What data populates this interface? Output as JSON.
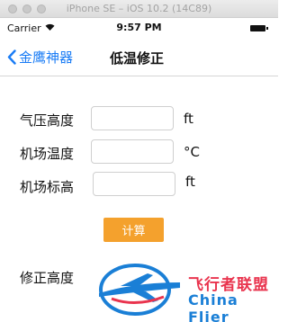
{
  "simulator": {
    "title": "iPhone SE – iOS 10.2 (14C89)"
  },
  "status_bar": {
    "carrier": "Carrier",
    "time": "9:57 PM"
  },
  "nav": {
    "back_label": "金鹰神器",
    "title": "低温修正"
  },
  "form": {
    "rows": [
      {
        "label": "气压高度",
        "value": "",
        "placeholder": "",
        "unit": "ft"
      },
      {
        "label": "机场温度",
        "value": "",
        "placeholder": "",
        "unit": "°C"
      },
      {
        "label": "机场标高",
        "value": "",
        "placeholder": "",
        "unit": "ft"
      }
    ],
    "calc_button": "计算",
    "result_label": "修正高度"
  },
  "watermark": {
    "cn": "飞行者联盟",
    "en": "China Flier"
  },
  "colors": {
    "accent": "#1a7cf5",
    "button": "#f4a12d",
    "watermark_red": "#e9344e",
    "watermark_blue": "#1a7fd6"
  }
}
